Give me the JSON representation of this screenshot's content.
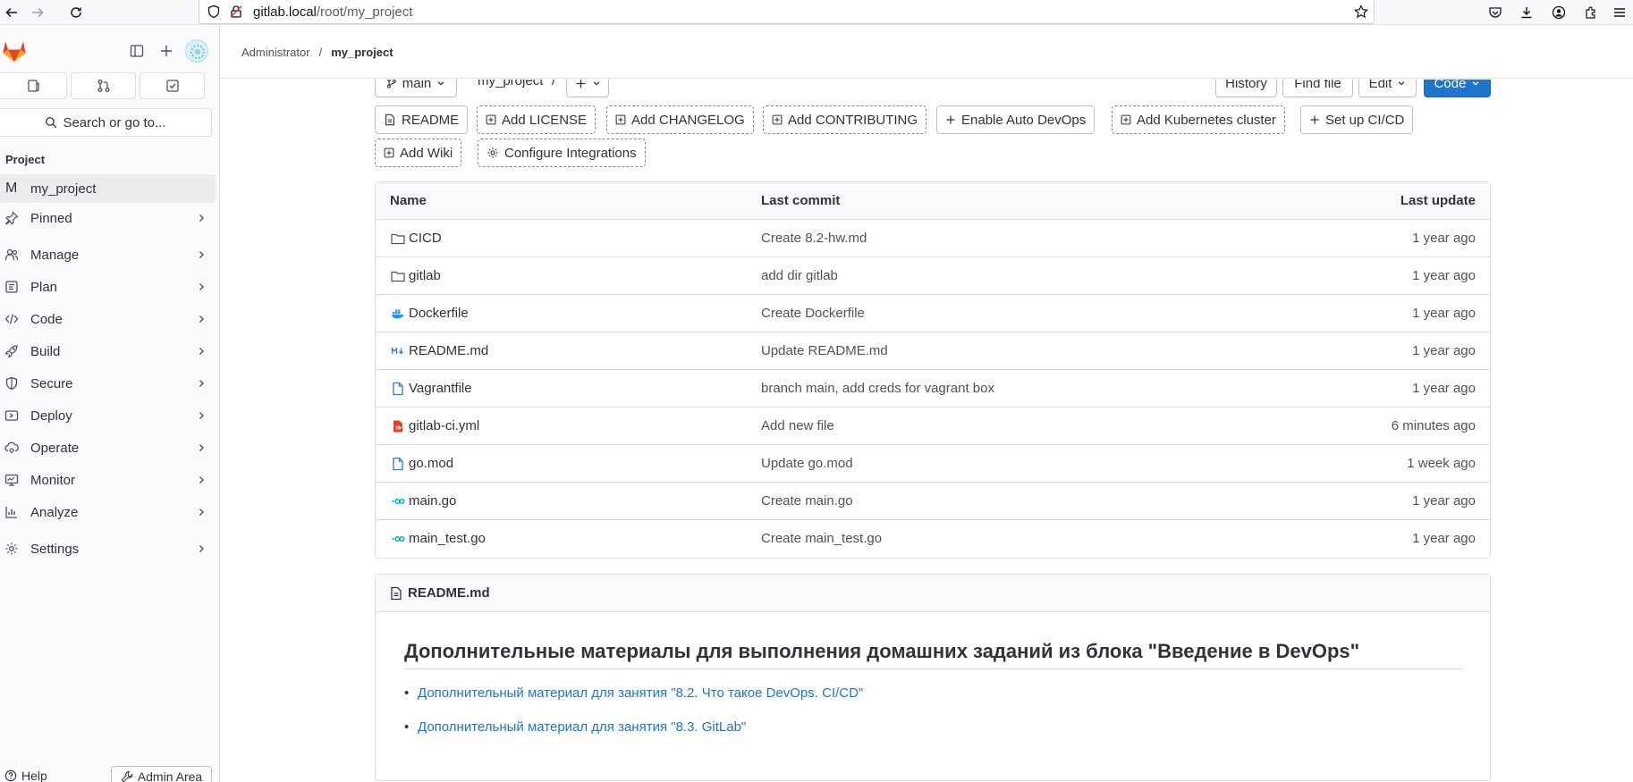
{
  "browser": {
    "url_host": "gitlab.local",
    "url_path": "/root/my_project"
  },
  "sidebar": {
    "section_title": "Project",
    "search_placeholder": "Search or go to...",
    "project_initial": "M",
    "project_name": "my_project",
    "items": [
      {
        "label": "Pinned",
        "icon": "pin-icon"
      },
      {
        "label": "Manage",
        "icon": "users-icon"
      },
      {
        "label": "Plan",
        "icon": "planning-icon"
      },
      {
        "label": "Code",
        "icon": "code-icon"
      },
      {
        "label": "Build",
        "icon": "rocket-icon"
      },
      {
        "label": "Secure",
        "icon": "shield-icon"
      },
      {
        "label": "Deploy",
        "icon": "deployments-icon"
      },
      {
        "label": "Operate",
        "icon": "cloud-gear-icon"
      },
      {
        "label": "Monitor",
        "icon": "monitor-icon"
      },
      {
        "label": "Analyze",
        "icon": "chart-icon"
      },
      {
        "label": "Settings",
        "icon": "gear-icon"
      }
    ],
    "help_label": "Help",
    "admin_label": "Admin Area"
  },
  "header": {
    "breadcrumb": [
      "Administrator",
      "my_project"
    ]
  },
  "repo_controls": {
    "branch": "main",
    "path": "my_project",
    "path_sep": "/",
    "history": "History",
    "find_file": "Find file",
    "edit": "Edit",
    "code": "Code"
  },
  "quick_actions": [
    {
      "label": "README",
      "icon": "doc-icon"
    },
    {
      "label": "Add LICENSE",
      "icon": "plus-square-icon"
    },
    {
      "label": "Add CHANGELOG",
      "icon": "plus-square-icon"
    },
    {
      "label": "Add CONTRIBUTING",
      "icon": "plus-square-icon"
    },
    {
      "label": "Enable Auto DevOps",
      "icon": "plus-icon"
    },
    {
      "label": "Add Kubernetes cluster",
      "icon": "plus-square-icon"
    },
    {
      "label": "Set up CI/CD",
      "icon": "plus-icon"
    },
    {
      "label": "Add Wiki",
      "icon": "plus-square-icon"
    },
    {
      "label": "Configure Integrations",
      "icon": "gear-icon"
    }
  ],
  "file_tree": {
    "headers": {
      "name": "Name",
      "commit": "Last commit",
      "update": "Last update"
    },
    "rows": [
      {
        "name": "CICD",
        "type": "folder",
        "commit": "Create 8.2-hw.md",
        "update": "1 year ago"
      },
      {
        "name": "gitlab",
        "type": "folder",
        "commit": "add dir gitlab",
        "update": "1 year ago"
      },
      {
        "name": "Dockerfile",
        "type": "docker",
        "commit": "Create Dockerfile",
        "update": "1 year ago"
      },
      {
        "name": "README.md",
        "type": "markdown",
        "commit": "Update README.md",
        "update": "1 year ago"
      },
      {
        "name": "Vagrantfile",
        "type": "file",
        "commit": "branch main, add creds for vagrant box",
        "update": "1 year ago"
      },
      {
        "name": "gitlab-ci.yml",
        "type": "yaml",
        "commit": "Add new file",
        "update": "6 minutes ago"
      },
      {
        "name": "go.mod",
        "type": "file",
        "commit": "Update go.mod",
        "update": "1 week ago"
      },
      {
        "name": "main.go",
        "type": "go",
        "commit": "Create main.go",
        "update": "1 year ago"
      },
      {
        "name": "main_test.go",
        "type": "go",
        "commit": "Create main_test.go",
        "update": "1 year ago"
      }
    ]
  },
  "readme": {
    "filename": "README.md",
    "heading": "Дополнительные материалы для выполнения домашних заданий из блока \"Введение в DevOps\"",
    "links": [
      "Дополнительный материал для занятия \"8.2. Что такое DevOps. CI/CD\"",
      "Дополнительный материал для занятия \"8.3. GitLab\""
    ]
  },
  "colors": {
    "accent": "#1f75cb",
    "gitlab_orange": "#e24329"
  }
}
